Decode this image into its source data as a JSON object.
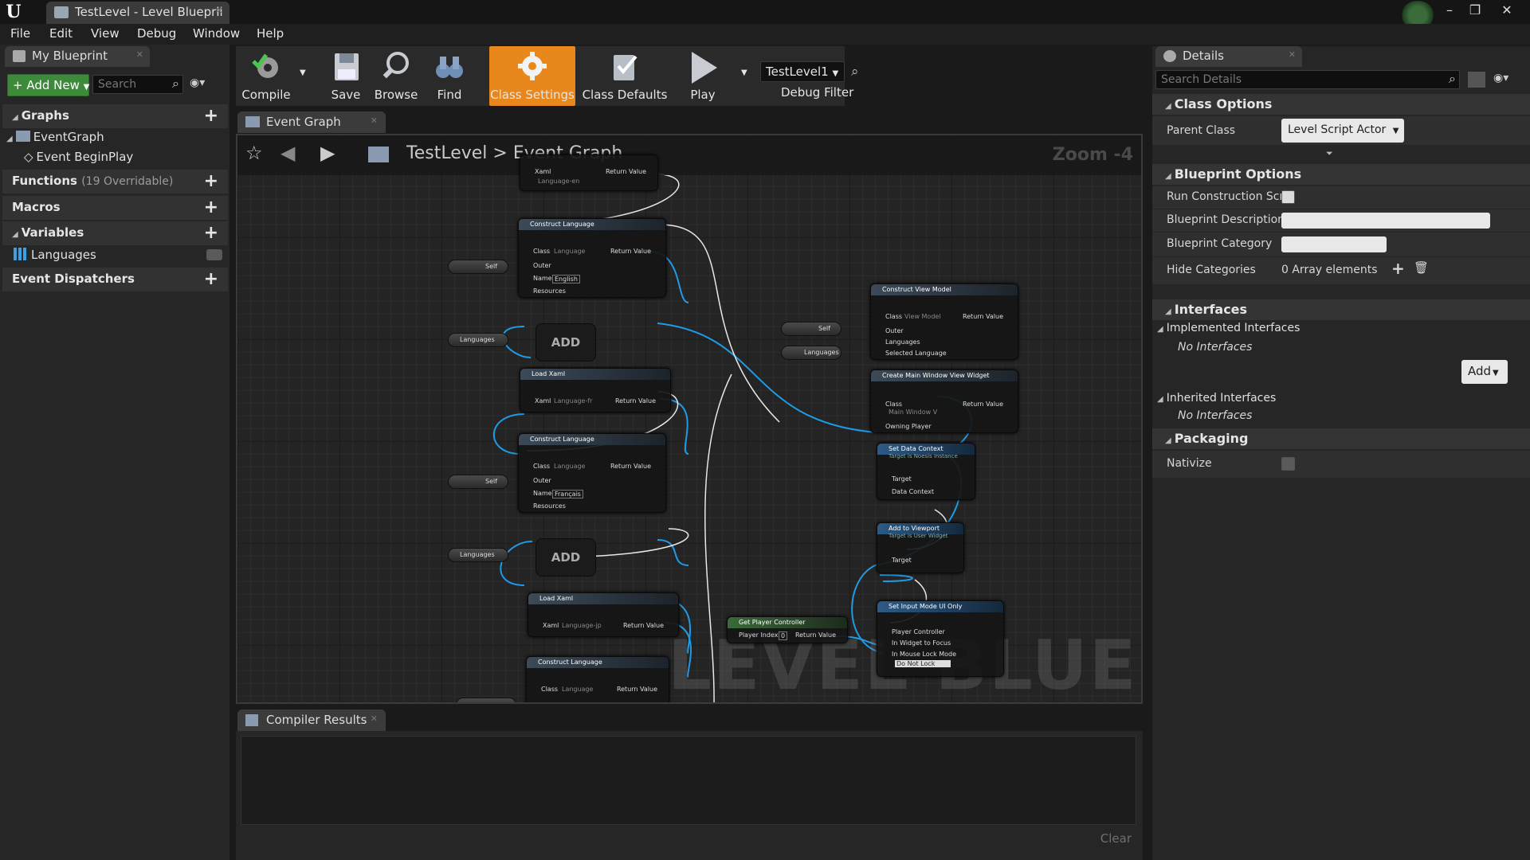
{
  "window": {
    "tab_title": "TestLevel - Level Blueprii",
    "logo": "U",
    "controls": {
      "minimize": "–",
      "restore": "❐",
      "close": "✕"
    }
  },
  "menu": [
    "File",
    "Edit",
    "View",
    "Debug",
    "Window",
    "Help"
  ],
  "my_blueprint": {
    "tab_label": "My Blueprint",
    "add_new_label": "+ Add New",
    "search_placeholder": "Search",
    "graphs_label": "Graphs",
    "event_graph_label": "EventGraph",
    "begin_play_label": "Event BeginPlay",
    "functions_label": "Functions",
    "functions_sub": "(19 Overridable)",
    "macros_label": "Macros",
    "variables_label": "Variables",
    "languages_var": "Languages",
    "dispatchers_label": "Event Dispatchers"
  },
  "toolbar": {
    "compile": "Compile",
    "save": "Save",
    "browse": "Browse",
    "find": "Find",
    "class_settings": "Class Settings",
    "class_defaults": "Class Defaults",
    "play": "Play",
    "debug_value": "TestLevel1",
    "debug_filter": "Debug Filter"
  },
  "graph": {
    "tab_label": "Event Graph",
    "crumb_level": "TestLevel",
    "crumb_sep": ">",
    "crumb_graph": "Event Graph",
    "zoom": "Zoom -4",
    "watermark": "LEVEL BLUEPRINT",
    "nodes": {
      "xaml": "Xaml",
      "language_en": "Language-en",
      "return_value": "Return Value",
      "construct_language": "Construct Language",
      "class": "Class",
      "language_cls": "Language",
      "outer": "Outer",
      "name": "Name",
      "english": "English",
      "resources": "Resources",
      "self": "Self",
      "languages": "Languages",
      "add": "ADD",
      "load_xaml": "Load Xaml",
      "language_fr": "Language-fr",
      "francais": "Français",
      "language_jp": "Language-jp",
      "construct_view_model": "Construct View Model",
      "view_model": "View Model",
      "selected_language": "Selected Language",
      "create_widget": "Create Main Window View Widget",
      "main_window": "Main Window V",
      "owning_player": "Owning Player",
      "set_data_context": "Set Data Context",
      "target_noesis": "Target is Noesis Instance",
      "target": "Target",
      "data_context": "Data Context",
      "add_to_viewport": "Add to Viewport",
      "target_user_widget": "Target is User Widget",
      "get_player_controller": "Get Player Controller",
      "player_index": "Player Index",
      "player_index_value": "0",
      "set_input_mode": "Set Input Mode UI Only",
      "player_controller": "Player Controller",
      "widget_to_focus": "In Widget to Focus",
      "mouse_lock_mode": "In Mouse Lock Mode",
      "do_not_lock": "Do Not Lock"
    }
  },
  "compiler": {
    "tab_label": "Compiler Results",
    "clear_label": "Clear"
  },
  "details": {
    "tab_label": "Details",
    "search_placeholder": "Search Details",
    "class_options": "Class Options",
    "parent_class_label": "Parent Class",
    "parent_class_value": "Level Script Actor",
    "blueprint_options": "Blueprint Options",
    "run_construction": "Run Construction Scr",
    "blueprint_description": "Blueprint Description",
    "blueprint_category": "Blueprint Category",
    "hide_categories": "Hide Categories",
    "array_elements": "0 Array elements",
    "interfaces": "Interfaces",
    "implemented_interfaces": "Implemented Interfaces",
    "no_interfaces_1": "No Interfaces",
    "add_button": "Add",
    "inherited_interfaces": "Inherited Interfaces",
    "no_interfaces_2": "No Interfaces",
    "packaging": "Packaging",
    "nativize": "Nativize"
  },
  "colors": {
    "accent_orange": "#e8871b",
    "add_new_green": "#3d8a3a",
    "wire_blue": "#1f9be6",
    "exec_white": "#ffffff"
  }
}
